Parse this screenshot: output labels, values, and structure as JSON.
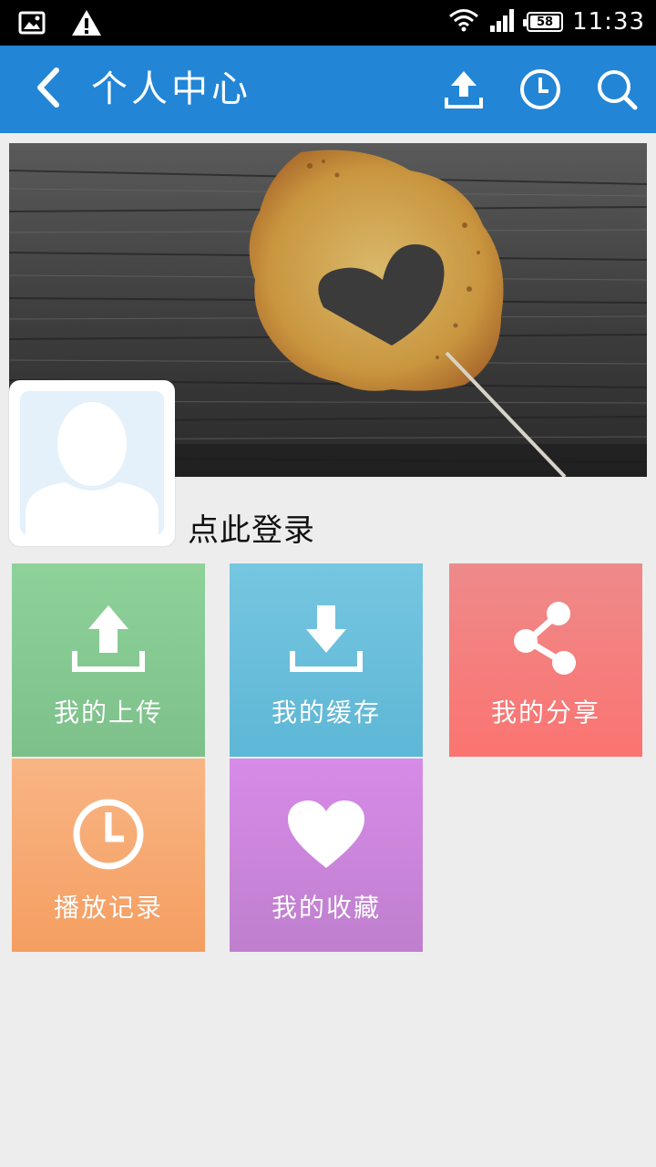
{
  "status_bar": {
    "time": "11:33",
    "battery": "58",
    "icons": [
      "image-notification-icon",
      "warning-icon",
      "wifi-icon",
      "signal-icon",
      "battery-icon"
    ]
  },
  "app_bar": {
    "title": "个人中心",
    "back_icon": "chevron-left-icon",
    "actions": [
      "upload-icon",
      "history-clock-icon",
      "search-icon"
    ],
    "color": "#2285d6"
  },
  "profile": {
    "login_prompt": "点此登录",
    "avatar_icon": "default-avatar-icon"
  },
  "tiles": [
    {
      "label": "我的上传",
      "icon": "upload-icon",
      "color": "#8ed29a"
    },
    {
      "label": "我的缓存",
      "icon": "download-icon",
      "color": "#6bbfdc"
    },
    {
      "label": "我的分享",
      "icon": "share-icon",
      "color": "#f47e7d"
    },
    {
      "label": "播放记录",
      "icon": "clock-icon",
      "color": "#f7aa72"
    },
    {
      "label": "我的收藏",
      "icon": "heart-icon",
      "color": "#cd85dc"
    }
  ]
}
